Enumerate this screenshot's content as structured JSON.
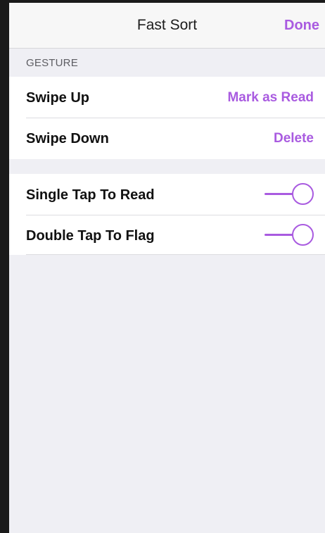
{
  "navbar": {
    "title": "Fast Sort",
    "done_label": "Done"
  },
  "gesture_section": {
    "header": "GESTURE",
    "rows": [
      {
        "label": "Swipe Up",
        "value": "Mark as Read"
      },
      {
        "label": "Swipe Down",
        "value": "Delete"
      }
    ]
  },
  "toggle_section": {
    "rows": [
      {
        "label": "Single Tap To Read",
        "enabled": true
      },
      {
        "label": "Double Tap To Flag",
        "enabled": true
      }
    ]
  },
  "colors": {
    "accent": "#a95be0",
    "background": "#efeff4",
    "navbar": "#f7f7f7"
  }
}
